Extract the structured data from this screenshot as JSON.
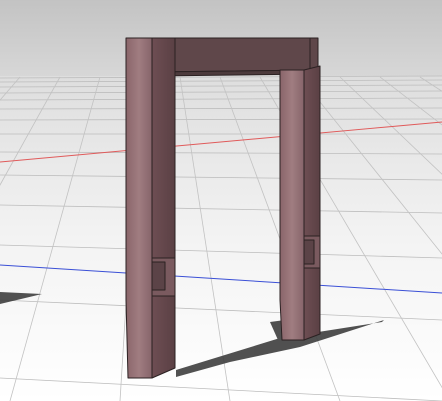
{
  "viewport": {
    "kind": "3d-modeling-viewport",
    "scene": "door-frame-model",
    "colors": {
      "sky_top": "#c6c6c6",
      "sky_horizon": "#d9d9d9",
      "ground_near": "#ffffff",
      "ground_far": "#e3e3e3",
      "grid_line": "#b8b8b8",
      "x_axis": "#e05050",
      "y_axis": "#3a4fd6",
      "wood_front": "#8e6a6f",
      "wood_side": "#6a4b50",
      "wood_top": "#5b4447",
      "wood_edge": "#2b2122",
      "shadow": "#3f3f3f"
    },
    "objects": [
      {
        "name": "left-post",
        "icon": "box-mesh-icon"
      },
      {
        "name": "right-post",
        "icon": "box-mesh-icon"
      },
      {
        "name": "top-beam",
        "icon": "box-mesh-icon"
      }
    ]
  }
}
